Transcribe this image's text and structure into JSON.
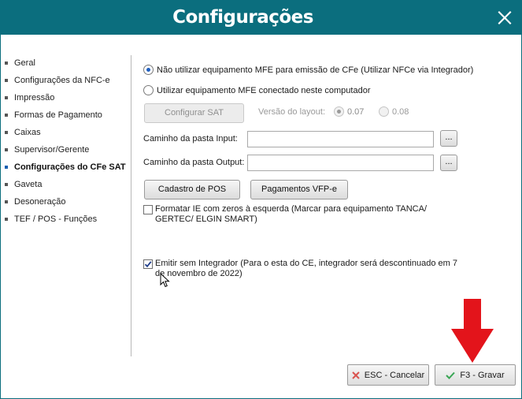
{
  "window": {
    "title": "Configurações",
    "close_label": "X"
  },
  "sidebar": {
    "items": [
      {
        "label": "Geral"
      },
      {
        "label": "Configurações da NFC-e"
      },
      {
        "label": "Impressão"
      },
      {
        "label": "Formas de Pagamento"
      },
      {
        "label": "Caixas"
      },
      {
        "label": "Supervisor/Gerente"
      },
      {
        "label": "Configurações do CFe SAT",
        "active": true
      },
      {
        "label": "Gaveta"
      },
      {
        "label": "Desoneração"
      },
      {
        "label": "TEF / POS - Funções"
      }
    ]
  },
  "mfe_mode": {
    "option_no_mfe": "Não utilizar equipamento MFE para emissão de CFe (Utilizar NFCe via Integrador)",
    "option_use_mfe": "Utilizar equipamento MFE conectado neste computador",
    "selected": "option_no_mfe"
  },
  "sat": {
    "configure_button": "Configurar SAT",
    "layout_version_label": "Versão do layout:",
    "version_options": [
      "0.07",
      "0.08"
    ],
    "selected_version": "0.07"
  },
  "paths": {
    "input_label": "Caminho da pasta Input:",
    "input_value": "",
    "output_label": "Caminho da pasta Output:",
    "output_value": "",
    "browse_label": "..."
  },
  "actions": {
    "pos_register_button": "Cadastro de POS",
    "vfp_payments_button": "Pagamentos VFP-e"
  },
  "options": {
    "format_ie_label": "Formatar IE com zeros à esquerda (Marcar para equipamento TANCA/ GERTEC/ ELGIN SMART)",
    "format_ie_checked": false,
    "emit_without_integrator_label": "Emitir sem Integrador (Para o esta do CE, integrador será descontinuado em  7 de novembro de 2022)",
    "emit_without_integrator_checked": true
  },
  "footer": {
    "cancel_button": "ESC - Cancelar",
    "save_button": "F3 - Gravar"
  },
  "colors": {
    "titlebar": "#0b6e7e",
    "accent_arrow": "#e3141b",
    "radio_selected": "#1f5fbf",
    "cancel_icon": "#d9534f",
    "save_icon": "#3aa655"
  }
}
